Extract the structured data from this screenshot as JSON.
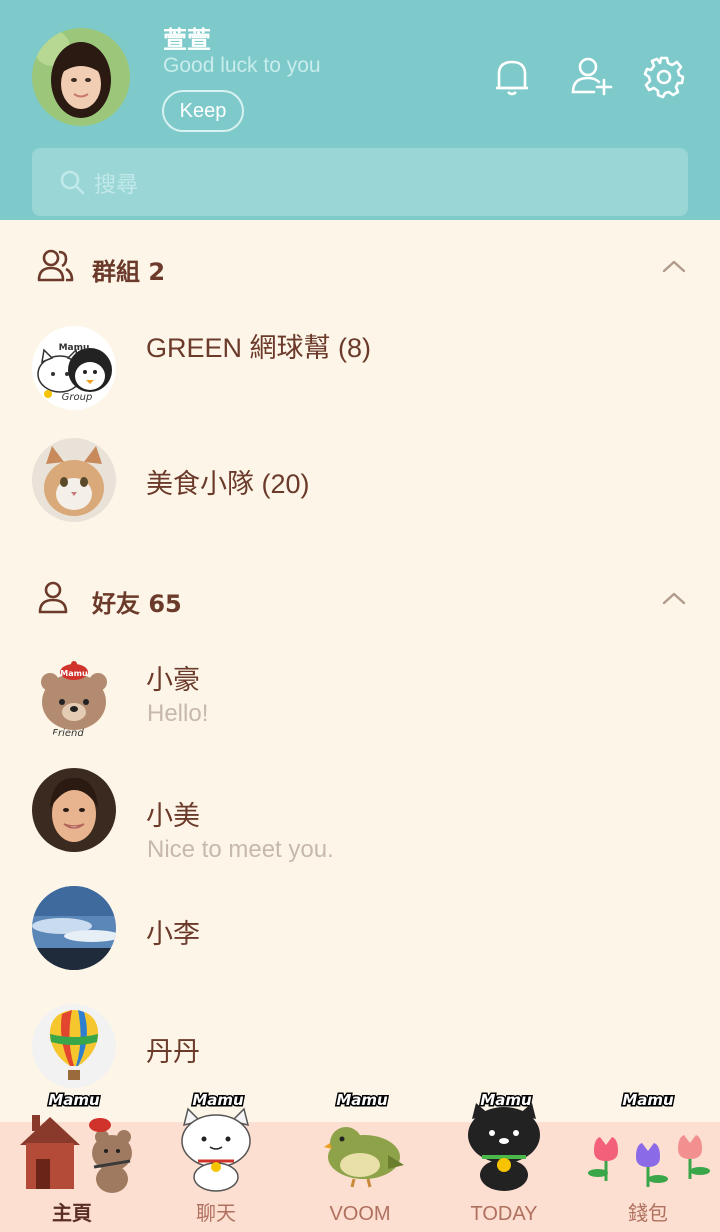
{
  "profile": {
    "name": "萱萱",
    "status": "Good luck to you",
    "keep_label": "Keep"
  },
  "header_icons": [
    "bell-icon",
    "add-friend-icon",
    "settings-gear-icon"
  ],
  "search": {
    "placeholder": "搜尋"
  },
  "groups_section": {
    "title": "群組 2",
    "items": [
      {
        "name": "GREEN 網球幫 (8)",
        "avatar_text": "Mamu",
        "avatar_caption": "Group"
      },
      {
        "name": "美食小隊 (20)"
      }
    ]
  },
  "friends_section": {
    "title": "好友 65",
    "items": [
      {
        "name": "小豪",
        "status": "Hello!",
        "avatar_text": "Mamu",
        "avatar_caption": "Friend"
      },
      {
        "name": "小美",
        "status": "Nice to meet you."
      },
      {
        "name": "小李"
      },
      {
        "name": "丹丹"
      }
    ]
  },
  "bottom_nav": {
    "items": [
      {
        "label": "主頁",
        "badge": "Mamu",
        "active": true
      },
      {
        "label": "聊天",
        "badge": "Mamu"
      },
      {
        "label": "VOOM",
        "badge": "Mamu"
      },
      {
        "label": "TODAY",
        "badge": "Mamu"
      },
      {
        "label": "錢包",
        "badge": "Mamu"
      }
    ]
  },
  "colors": {
    "header_bg": "#7ecaca",
    "list_bg": "#fdf6e8",
    "nav_bg": "#fcdfd0",
    "text_primary": "#6b3a2a",
    "text_secondary": "#c6b8ad"
  }
}
